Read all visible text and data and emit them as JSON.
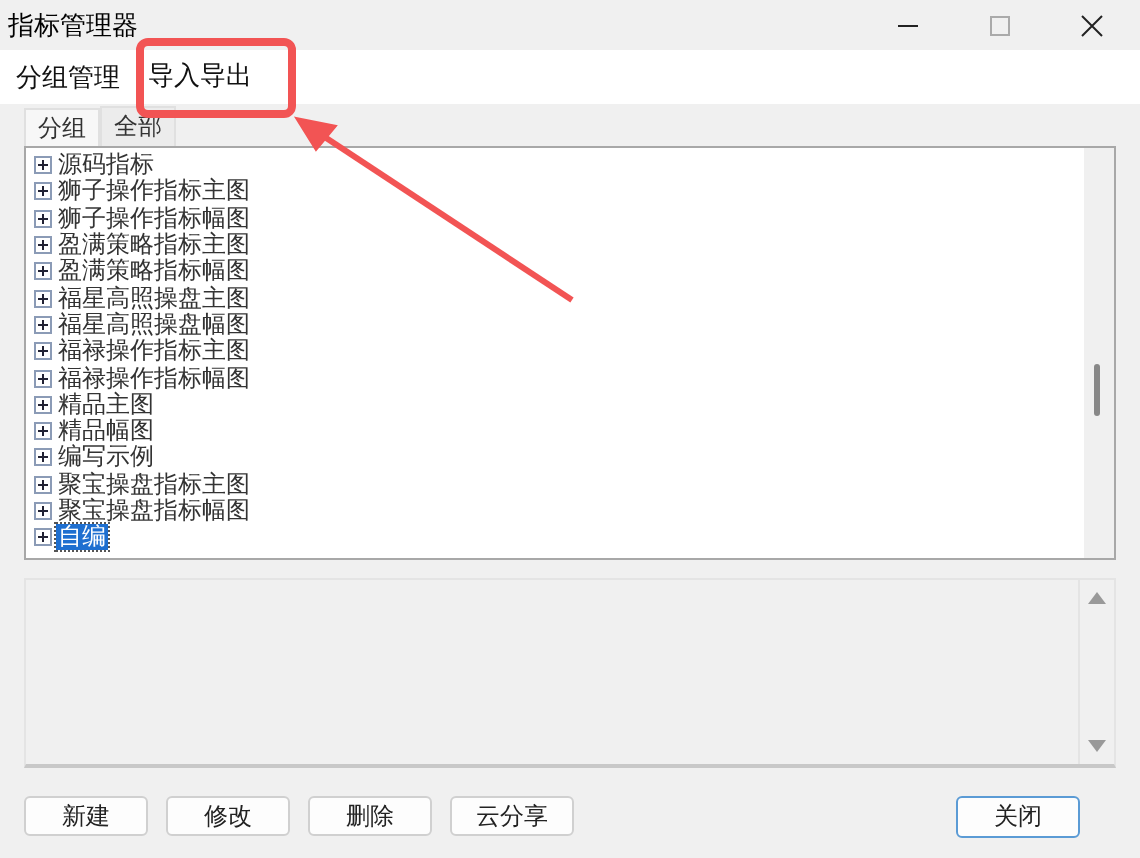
{
  "window": {
    "title": "指标管理器"
  },
  "menu": [
    {
      "label": "分组管理",
      "highlighted": false
    },
    {
      "label": "导入导出",
      "highlighted": true
    }
  ],
  "tabs": [
    {
      "label": "分组",
      "selected": true
    },
    {
      "label": "全部",
      "selected": false
    }
  ],
  "tree": [
    {
      "label": "源码指标",
      "expanded": false,
      "selected": false
    },
    {
      "label": "狮子操作指标主图",
      "expanded": false,
      "selected": false
    },
    {
      "label": "狮子操作指标幅图",
      "expanded": false,
      "selected": false
    },
    {
      "label": "盈满策略指标主图",
      "expanded": false,
      "selected": false
    },
    {
      "label": "盈满策略指标幅图",
      "expanded": false,
      "selected": false
    },
    {
      "label": "福星高照操盘主图",
      "expanded": false,
      "selected": false
    },
    {
      "label": "福星高照操盘幅图",
      "expanded": false,
      "selected": false
    },
    {
      "label": "福禄操作指标主图",
      "expanded": false,
      "selected": false
    },
    {
      "label": "福禄操作指标幅图",
      "expanded": false,
      "selected": false
    },
    {
      "label": "精品主图",
      "expanded": false,
      "selected": false
    },
    {
      "label": "精品幅图",
      "expanded": false,
      "selected": false
    },
    {
      "label": "编写示例",
      "expanded": false,
      "selected": false
    },
    {
      "label": "聚宝操盘指标主图",
      "expanded": false,
      "selected": false
    },
    {
      "label": "聚宝操盘指标幅图",
      "expanded": false,
      "selected": false
    },
    {
      "label": "自编",
      "expanded": false,
      "selected": true
    }
  ],
  "buttons": [
    {
      "label": "新建",
      "kind": "left"
    },
    {
      "label": "修改",
      "kind": "left"
    },
    {
      "label": "删除",
      "kind": "left"
    },
    {
      "label": "云分享",
      "kind": "left"
    },
    {
      "label": "关闭",
      "kind": "default"
    }
  ]
}
